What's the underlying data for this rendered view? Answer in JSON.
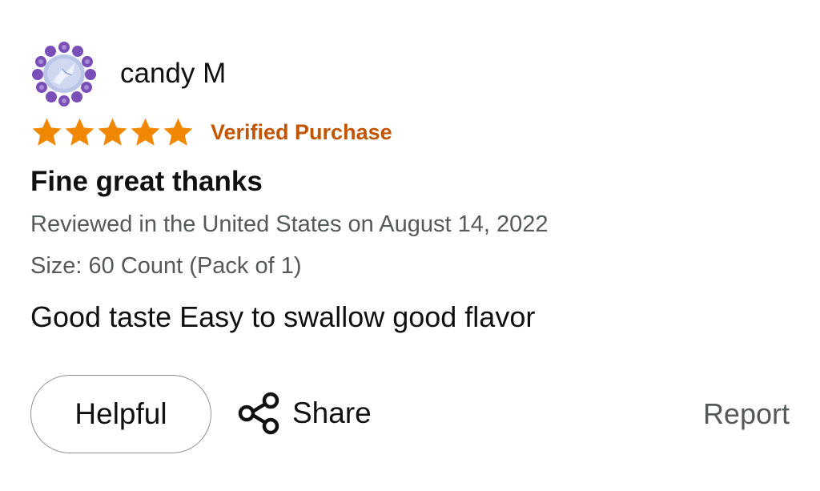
{
  "review": {
    "author": "candy M",
    "avatar": "flower-gem-avatar",
    "rating": 5,
    "rating_max": 5,
    "verified_label": "Verified Purchase",
    "title": "Fine great thanks",
    "date_line": "Reviewed in the United States on August 14, 2022",
    "size_line": "Size: 60 Count (Pack of 1)",
    "body": "Good taste Easy to swallow good flavor"
  },
  "actions": {
    "helpful_label": "Helpful",
    "share_label": "Share",
    "share_icon": "share-icon",
    "report_label": "Report"
  },
  "colors": {
    "star": "#f08804",
    "verified": "#c45500",
    "secondary_text": "#565959",
    "primary_text": "#0f1111",
    "button_border": "#8d9096"
  }
}
